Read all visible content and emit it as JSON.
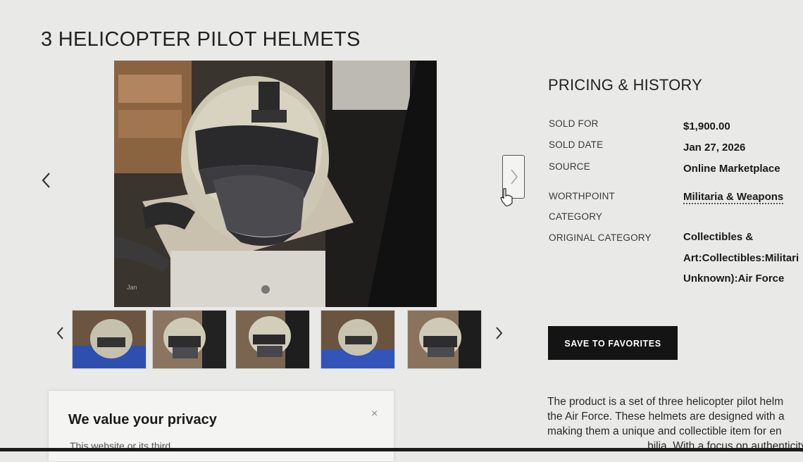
{
  "listing": {
    "title": "3 HELICOPTER PILOT HELMETS",
    "image_watermark": "Jan"
  },
  "pricing": {
    "heading": "PRICING & HISTORY",
    "rows": [
      {
        "label": "SOLD FOR",
        "value": "$1,900.00"
      },
      {
        "label": "SOLD DATE",
        "value": "Jan 27, 2026"
      },
      {
        "label": "SOURCE",
        "value": "Online Marketplace"
      },
      {
        "label_line1": "WORTHPOINT",
        "label_line2": "CATEGORY",
        "value": "Militaria & Weapons"
      },
      {
        "label": "ORIGINAL CATEGORY",
        "value_line1": "Collectibles &",
        "value_line2": "Art:Collectibles:Militari",
        "value_line3": "Unknown):Air Force"
      }
    ]
  },
  "actions": {
    "save_label": "SAVE TO FAVORITES"
  },
  "description": {
    "lines": [
      "The product is a set of three helicopter pilot helm",
      "the Air Force. These helmets are designed with a",
      "making them a unique and collectible item for en",
      "                                 bilia. With a focus on authenticity"
    ]
  },
  "privacy": {
    "title": "We value your privacy",
    "close": "×",
    "body": "This website or its third"
  },
  "icons": {
    "prev": "chevron-left-icon",
    "next": "chevron-right-icon",
    "close": "close-icon",
    "cursor": "hand-cursor-icon"
  },
  "colors": {
    "background": "#e9e9e7",
    "button": "#141414",
    "button_text": "#ffffff"
  }
}
